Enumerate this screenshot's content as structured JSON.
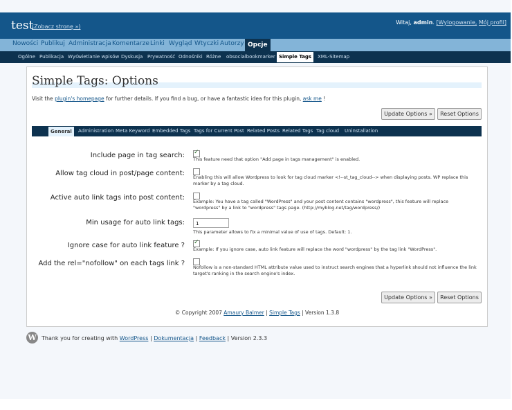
{
  "header": {
    "site_title": "test",
    "view_site": "(Zobacz stronę »)",
    "greeting": "Witaj,",
    "user": "admin",
    "logout": "[Wylogowanie,",
    "profile": "Mój profil]"
  },
  "admin_menu": [
    "Nowości",
    "Publikuj",
    "Administracja",
    "Komentarze",
    "Linki",
    "Wygląd",
    "Wtyczki",
    "Autorzy",
    "Opcje"
  ],
  "sub_menu": [
    "Ogólne",
    "Publikacja",
    "Wyświetlanie wpisów",
    "Dyskusja",
    "Prywatność",
    "Odnośniki",
    "Różne",
    "obsocialbookmarker",
    "Simple Tags",
    "XML-Sitemap"
  ],
  "page": {
    "title": "Simple Tags: Options",
    "intro_pre": "Visit the",
    "intro_link1": "plugin's homepage",
    "intro_mid": "for further details. If you find a bug, or have a fantastic idea for this plugin,",
    "intro_link2": "ask me",
    "intro_post": "!",
    "update_button": "Update Options »",
    "reset_button": "Reset Options"
  },
  "tabs": [
    "General",
    "Administration",
    "Meta Keyword",
    "Embedded Tags",
    "Tags for Current Post",
    "Related Posts",
    "Related Tags",
    "Tag cloud",
    "Uninstallation"
  ],
  "options": [
    {
      "label": "Include page in tag search:",
      "checked": true,
      "desc": "This feature need that option \"Add page in tags management\" is enabled."
    },
    {
      "label": "Allow tag cloud in post/page content:",
      "checked": false,
      "desc": "Enabling this will allow Wordpress to look for tag cloud marker <!--st_tag_cloud--> when displaying posts. WP replace this marker by a tag cloud."
    },
    {
      "label": "Active auto link tags into post content:",
      "checked": false,
      "desc": "Example: You have a tag called \"WordPress\" and your post content contains \"wordpress\", this feature will replace \"wordpress\" by a link to \"wordpress\" tags page. (http://myblog.net/tag/wordpress/)"
    },
    {
      "label": "Min usage for auto link tags:",
      "value": "1",
      "desc": "This parameter allows to fix a minimal value of use of tags. Default: 1."
    },
    {
      "label": "Ignore case for auto link feature ?",
      "checked": true,
      "desc": "Example: If you ignore case, auto link feature will replace the word \"wordpress\" by the tag link \"WordPress\"."
    },
    {
      "label": "Add the rel=\"nofollow\" on each tags link ?",
      "checked": false,
      "desc": "Nofollow is a non-standard HTML attribute value used to instruct search engines that a hyperlink should not influence the link target's ranking in the search engine's index."
    }
  ],
  "copyright": {
    "pre": "© Copyright 2007",
    "author": "Amaury Balmer",
    "sep1": "|",
    "plugin": "Simple Tags",
    "version": "| Version 1.3.8"
  },
  "footer": {
    "text": "Thank you for creating with",
    "wp_link": "WordPress",
    "sep1": "|",
    "docs": "Dokumentacja",
    "sep2": "|",
    "feedback": "Feedback",
    "version": "| Version 2.3.3"
  },
  "colors": {
    "header": "#14568a",
    "menu": "#83b4d8",
    "submenu": "#0d324f"
  }
}
